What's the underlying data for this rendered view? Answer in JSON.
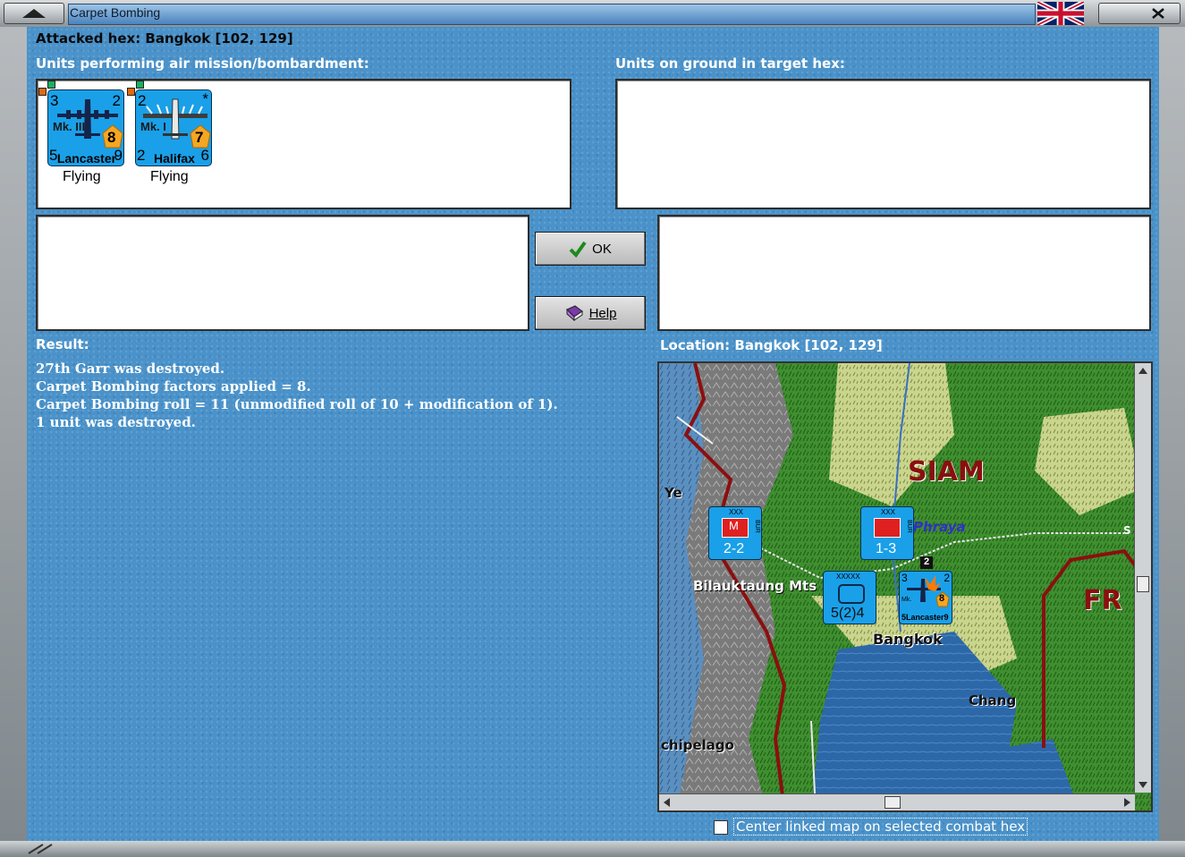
{
  "window": {
    "title": "Carpet Bombing"
  },
  "header": {
    "attacked_hex": "Attacked hex: Bangkok  [102, 129]",
    "air_units_label": "Units performing air mission/bombardment:",
    "ground_units_label": "Units on ground in target hex:"
  },
  "air_units": [
    {
      "top_left": "3",
      "top_right": "2",
      "mark": "Mk. III",
      "bottom_left": "5",
      "name": "Lancaster",
      "bottom_right": "9",
      "badge": "8",
      "status": "Flying"
    },
    {
      "top_left": "2",
      "top_right": "*",
      "mark": "Mk. I",
      "bottom_left": "2",
      "name": "Halifax",
      "bottom_right": "6",
      "badge": "7",
      "status": "Flying"
    }
  ],
  "buttons": {
    "ok": "OK",
    "help": "Help"
  },
  "result": {
    "label": "Result:",
    "lines": [
      "27th Garr was destroyed.",
      "Carpet Bombing factors applied = 8.",
      "Carpet Bombing roll = 11 (unmodified roll of 10 + modification of 1).",
      "1 unit was destroyed."
    ]
  },
  "location": {
    "label": "Location:  Bangkok  [102, 129]"
  },
  "map": {
    "labels": {
      "siam": "SIAM",
      "fr": "FR",
      "bangkok": "Bangkok",
      "bilauktaung": "Bilauktaung Mts",
      "chang": "Chang",
      "archipelago": "chipelago",
      "ye": "Ye",
      "phraya": "Phraya",
      "s": "S"
    },
    "units": [
      {
        "top": "XXX",
        "value": "2-2",
        "side": "BUR",
        "label": "M"
      },
      {
        "top": "XXX",
        "value": "1-3",
        "side": "BUR"
      },
      {
        "top": "XXXXX",
        "value": "5(2)4"
      },
      {
        "top_left": "3",
        "top_right": "2",
        "bottom": "5Lancaster9",
        "badge": "8",
        "stack": "2",
        "mark": "Mk."
      }
    ]
  },
  "footer": {
    "center_checkbox_label": "Center linked map on selected combat hex"
  },
  "colors": {
    "background": "#4a92c9",
    "counter_blue": "#1aa0e8",
    "badge_orange": "#f5a623",
    "border_red": "#8b0f0f"
  }
}
